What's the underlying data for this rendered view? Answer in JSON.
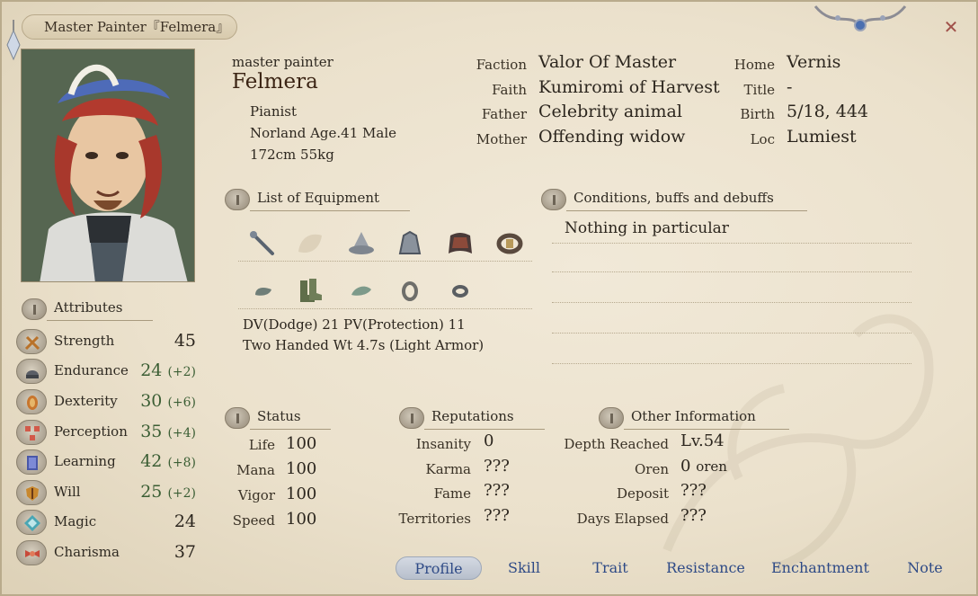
{
  "window": {
    "title": "Master Painter『Felmera』",
    "close_icon": "close-icon"
  },
  "identity": {
    "alias": "master painter",
    "name": "Felmera",
    "job": "Pianist",
    "race_age_sex": "Norland Age.41 Male",
    "height_weight": "172cm 55kg"
  },
  "bio": {
    "left": [
      {
        "label": "Faction",
        "value": "Valor Of Master"
      },
      {
        "label": "Faith",
        "value": "Kumiromi of Harvest"
      },
      {
        "label": "Father",
        "value": "Celebrity animal"
      },
      {
        "label": "Mother",
        "value": "Offending widow"
      }
    ],
    "right": [
      {
        "label": "Home",
        "value": "Vernis"
      },
      {
        "label": "Title",
        "value": "-"
      },
      {
        "label": "Birth",
        "value": "5/18, 444"
      },
      {
        "label": "Loc",
        "value": "Lumiest"
      }
    ]
  },
  "equipment": {
    "header": "List of Equipment",
    "row1_icons": [
      "staff-icon",
      "empty-slot-icon",
      "hat-icon",
      "armor-icon",
      "cloak-icon",
      "belt-icon"
    ],
    "row2_icons": [
      "gloves-icon",
      "boots-icon",
      "amulet-icon",
      "ring-icon",
      "ring2-icon"
    ],
    "dv_pv": "DV(Dodge) 21  PV(Protection) 11",
    "weight": "Two Handed Wt 4.7s (Light Armor)"
  },
  "conditions": {
    "header": "Conditions, buffs and debuffs",
    "text": "Nothing in particular"
  },
  "attributes": {
    "header": "Attributes",
    "items": [
      {
        "name": "Strength",
        "value": "45",
        "bonus": "",
        "icon": "sword-icon",
        "green": false
      },
      {
        "name": "Endurance",
        "value": "24",
        "bonus": "(+2)",
        "icon": "helmet-icon",
        "green": true
      },
      {
        "name": "Dexterity",
        "value": "30",
        "bonus": "(+6)",
        "icon": "hand-icon",
        "green": true
      },
      {
        "name": "Perception",
        "value": "35",
        "bonus": "(+4)",
        "icon": "eye-icon",
        "green": true
      },
      {
        "name": "Learning",
        "value": "42",
        "bonus": "(+8)",
        "icon": "book-icon",
        "green": true
      },
      {
        "name": "Will",
        "value": "25",
        "bonus": "(+2)",
        "icon": "shield-icon",
        "green": true
      },
      {
        "name": "Magic",
        "value": "24",
        "bonus": "",
        "icon": "crystal-icon",
        "green": false
      },
      {
        "name": "Charisma",
        "value": "37",
        "bonus": "",
        "icon": "ribbon-icon",
        "green": false
      }
    ]
  },
  "status": {
    "header": "Status",
    "items": [
      {
        "label": "Life",
        "value": "100"
      },
      {
        "label": "Mana",
        "value": "100"
      },
      {
        "label": "Vigor",
        "value": "100"
      },
      {
        "label": "Speed",
        "value": "100"
      }
    ]
  },
  "reputations": {
    "header": "Reputations",
    "items": [
      {
        "label": "Insanity",
        "value": "0"
      },
      {
        "label": "Karma",
        "value": "???"
      },
      {
        "label": "Fame",
        "value": "???"
      },
      {
        "label": "Territories",
        "value": "???"
      }
    ]
  },
  "other": {
    "header": "Other Information",
    "items": [
      {
        "label": "Depth Reached",
        "value": "Lv.54",
        "suffix": ""
      },
      {
        "label": "Oren",
        "value": "0",
        "suffix": "oren"
      },
      {
        "label": "Deposit",
        "value": "???",
        "suffix": ""
      },
      {
        "label": "Days Elapsed",
        "value": "???",
        "suffix": ""
      }
    ]
  },
  "tabs": [
    {
      "label": "Profile",
      "active": true
    },
    {
      "label": "Skill",
      "active": false
    },
    {
      "label": "Trait",
      "active": false
    },
    {
      "label": "Resistance",
      "active": false
    },
    {
      "label": "Enchantment",
      "active": false
    },
    {
      "label": "Note",
      "active": false
    }
  ],
  "colors": {
    "accent_tab": "#2e4a86",
    "bonus_green": "#3b5e34",
    "close": "#a0514a"
  }
}
